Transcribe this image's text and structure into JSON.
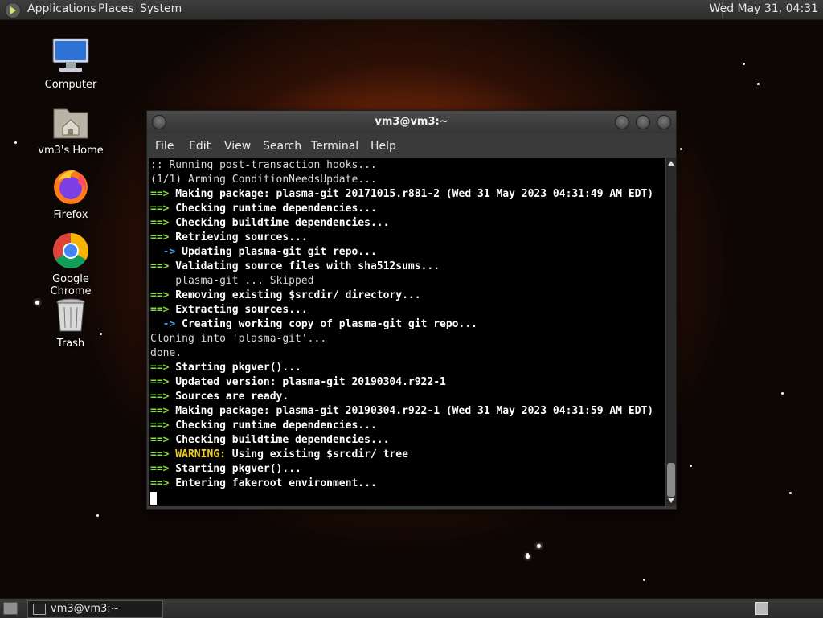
{
  "top_panel": {
    "menu": [
      "Applications",
      "Places",
      "System"
    ],
    "clock": "Wed May 31, 04:31"
  },
  "desktop_icons": [
    {
      "label": "Computer",
      "icon": "computer-icon"
    },
    {
      "label": "vm3's Home",
      "icon": "home-folder-icon"
    },
    {
      "label": "Firefox",
      "icon": "firefox-icon"
    },
    {
      "label": "Google Chrome",
      "icon": "chrome-icon"
    },
    {
      "label": "Trash",
      "icon": "trash-icon"
    }
  ],
  "terminal": {
    "title": "vm3@vm3:~",
    "menu": [
      "File",
      "Edit",
      "View",
      "Search",
      "Terminal",
      "Help"
    ],
    "lines": [
      {
        "prefix": "",
        "text": ":: Running post-transaction hooks...",
        "style": "plain"
      },
      {
        "prefix": "",
        "text": "(1/1) Arming ConditionNeedsUpdate...",
        "style": "plain"
      },
      {
        "prefix": "==>",
        "text": " Making package: plasma-git 20171015.r881-2 (Wed 31 May 2023 04:31:49 AM EDT)",
        "style": "bold"
      },
      {
        "prefix": "==>",
        "text": " Checking runtime dependencies...",
        "style": "bold"
      },
      {
        "prefix": "==>",
        "text": " Checking buildtime dependencies...",
        "style": "bold"
      },
      {
        "prefix": "==>",
        "text": " Retrieving sources...",
        "style": "bold"
      },
      {
        "prefix": "  ->",
        "text": " Updating plasma-git git repo...",
        "style": "sub"
      },
      {
        "prefix": "==>",
        "text": " Validating source files with sha512sums...",
        "style": "bold"
      },
      {
        "prefix": "",
        "text": "    plasma-git ... Skipped",
        "style": "plain"
      },
      {
        "prefix": "==>",
        "text": " Removing existing $srcdir/ directory...",
        "style": "bold"
      },
      {
        "prefix": "==>",
        "text": " Extracting sources...",
        "style": "bold"
      },
      {
        "prefix": "  ->",
        "text": " Creating working copy of plasma-git git repo...",
        "style": "sub"
      },
      {
        "prefix": "",
        "text": "Cloning into 'plasma-git'...",
        "style": "plain"
      },
      {
        "prefix": "",
        "text": "done.",
        "style": "plain"
      },
      {
        "prefix": "==>",
        "text": " Starting pkgver()...",
        "style": "bold"
      },
      {
        "prefix": "==>",
        "text": " Updated version: plasma-git 20190304.r922-1",
        "style": "bold"
      },
      {
        "prefix": "==>",
        "text": " Sources are ready.",
        "style": "bold"
      },
      {
        "prefix": "==>",
        "text": " Making package: plasma-git 20190304.r922-1 (Wed 31 May 2023 04:31:59 AM EDT)",
        "style": "bold"
      },
      {
        "prefix": "==>",
        "text": " Checking runtime dependencies...",
        "style": "bold"
      },
      {
        "prefix": "==>",
        "text": " Checking buildtime dependencies...",
        "style": "bold"
      },
      {
        "prefix": "==>",
        "warn": " WARNING:",
        "text": " Using existing $srcdir/ tree",
        "style": "warn"
      },
      {
        "prefix": "==>",
        "text": " Starting pkgver()...",
        "style": "bold"
      },
      {
        "prefix": "==>",
        "text": " Entering fakeroot environment...",
        "style": "bold"
      }
    ]
  },
  "bottom_panel": {
    "task_label": "vm3@vm3:~"
  }
}
